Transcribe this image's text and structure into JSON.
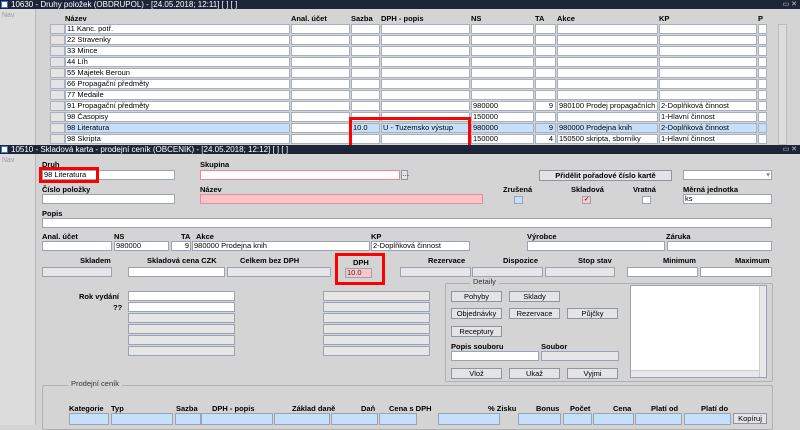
{
  "top_window": {
    "title": "10630 - Druhy položek (OBDRUPOL) - [24.05.2018; 12:11]  [ ]  [ ]",
    "nav": "Nav",
    "columns": [
      "Název",
      "Anal. účet",
      "Sazba",
      "DPH - popis",
      "NS",
      "TA",
      "Akce",
      "KP",
      "P"
    ],
    "rows": [
      {
        "nazev": "11 Kanc. potř.",
        "sazba": "",
        "dph": "",
        "ns": "",
        "ta": "",
        "akce": "",
        "kp": ""
      },
      {
        "nazev": "22 Stravenky",
        "sazba": "",
        "dph": "",
        "ns": "",
        "ta": "",
        "akce": "",
        "kp": ""
      },
      {
        "nazev": "33 Mince",
        "sazba": "",
        "dph": "",
        "ns": "",
        "ta": "",
        "akce": "",
        "kp": ""
      },
      {
        "nazev": "44 Líh",
        "sazba": "",
        "dph": "",
        "ns": "",
        "ta": "",
        "akce": "",
        "kp": ""
      },
      {
        "nazev": "55 Majetek Beroun",
        "sazba": "",
        "dph": "",
        "ns": "",
        "ta": "",
        "akce": "",
        "kp": ""
      },
      {
        "nazev": "66 Propagační předměty",
        "sazba": "",
        "dph": "",
        "ns": "",
        "ta": "",
        "akce": "",
        "kp": ""
      },
      {
        "nazev": "77 Medaile",
        "sazba": "",
        "dph": "",
        "ns": "",
        "ta": "",
        "akce": "",
        "kp": ""
      },
      {
        "nazev": "91 Propagační předměty",
        "sazba": "",
        "dph": "",
        "ns": "980000",
        "ta": "9",
        "akce": "980100 Prodej propagačních",
        "kp": "2-Doplňková činnost"
      },
      {
        "nazev": "98 Časopisy",
        "sazba": "",
        "dph": "",
        "ns": "150000",
        "ta": "",
        "akce": "",
        "kp": "1-Hlavní činnost"
      },
      {
        "nazev": "98 Literatura",
        "sazba": "10.0",
        "dph": "U - Tuzemsko výstup",
        "ns": "980000",
        "ta": "9",
        "akce": "980000 Prodejna knih",
        "kp": "2-Doplňková činnost"
      },
      {
        "nazev": "98 Skripta",
        "sazba": "",
        "dph": "",
        "ns": "150000",
        "ta": "4",
        "akce": "150500 skripta, sborníky",
        "kp": "1-Hlavní činnost"
      }
    ]
  },
  "bottom_window": {
    "title": "10510 - Skladová karta - prodejní ceník (OBCENIK) - [24.05.2018; 12:12]  [ ]  [ ]",
    "nav": "Nav",
    "labels": {
      "druh": "Druh",
      "skupina": "Skupina",
      "cislo": "Číslo položky",
      "nazev": "Název",
      "zrusena": "Zrušená",
      "skladova": "Skladová",
      "vratna": "Vratná",
      "mj": "Měrná jednotka",
      "popis": "Popis",
      "anal": "Anal. účet",
      "ns": "NS",
      "ta": "TA",
      "akce": "Akce",
      "kp": "KP",
      "vyrobce": "Výrobce",
      "zaruka": "Záruka",
      "skladem": "Skladem",
      "skl_cena": "Skladová cena CZK",
      "celkem": "Celkem bez DPH",
      "dph": "DPH",
      "rezervace": "Rezervace",
      "dispozice": "Dispozice",
      "stop": "Stop stav",
      "minimum": "Minimum",
      "maximum": "Maximum",
      "rok": "Rok vydání",
      "qq": "??",
      "popis_souboru": "Popis souboru",
      "soubor": "Soubor"
    },
    "values": {
      "druh": "98 Literatura",
      "mj": "ks",
      "ns": "980000",
      "ta": "9",
      "akce": "980000 Prodejna knih",
      "kp": "2-Doplňková činnost",
      "dph": "10.0"
    },
    "buttons": {
      "pridelit": "Přidělit pořadové číslo kartě",
      "pohyby": "Pohyby",
      "sklady": "Sklady",
      "objednavky": "Objednávky",
      "rezervace": "Rezervace",
      "pujcky": "Půjčky",
      "receptury": "Receptury",
      "vloz": "Vlož",
      "ukaz": "Ukaž",
      "vyjmi": "Vyjmi",
      "kopiruj": "Kopíruj"
    },
    "detaily": "Detaily",
    "cenik": {
      "title": "Prodejní ceník",
      "columns": [
        "Kategorie",
        "Typ",
        "Sazba",
        "DPH - popis",
        "Základ daně",
        "Daň",
        "Cena s DPH",
        "% Zisku",
        "Bonus",
        "Počet",
        "Cena",
        "Platí od",
        "Platí do"
      ]
    }
  }
}
